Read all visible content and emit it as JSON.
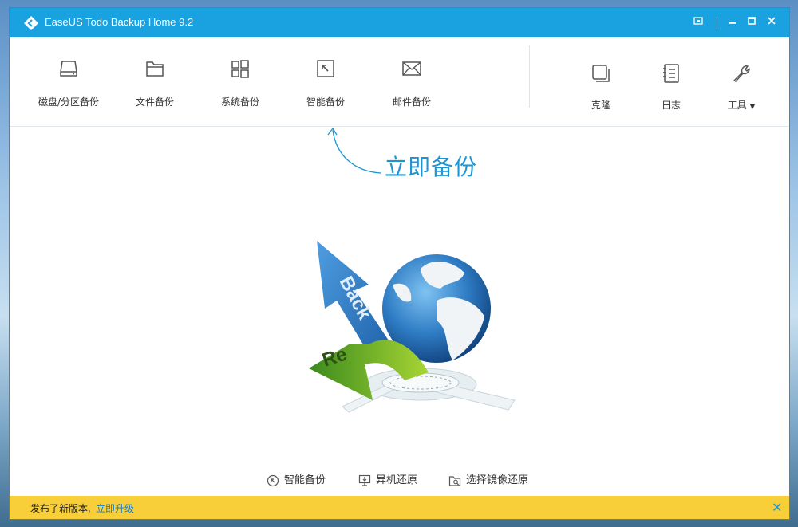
{
  "window": {
    "title": "EaseUS Todo Backup Home 9.2"
  },
  "toolbar": {
    "items": [
      {
        "label": "磁盘/分区备份",
        "icon": "disk-icon"
      },
      {
        "label": "文件备份",
        "icon": "folder-icon"
      },
      {
        "label": "系统备份",
        "icon": "windows-icon"
      },
      {
        "label": "智能备份",
        "icon": "smart-arrow-icon"
      },
      {
        "label": "邮件备份",
        "icon": "mail-icon"
      }
    ],
    "right_items": [
      {
        "label": "克隆",
        "icon": "clone-icon"
      },
      {
        "label": "日志",
        "icon": "log-icon"
      },
      {
        "label": "工具",
        "icon": "wrench-icon"
      }
    ]
  },
  "hint": {
    "text": "立即备份"
  },
  "illustration": {
    "banner_back": "Back",
    "banner_re": "Re"
  },
  "quick": {
    "smart_backup": "智能备份",
    "restore_other": "异机还原",
    "restore_image": "选择镜像还原"
  },
  "notice": {
    "text": "发布了新版本,",
    "link": "立即升级"
  },
  "colors": {
    "titlebar": "#1aa1e0",
    "accent": "#1a96d4",
    "notice": "#f9cf39"
  }
}
